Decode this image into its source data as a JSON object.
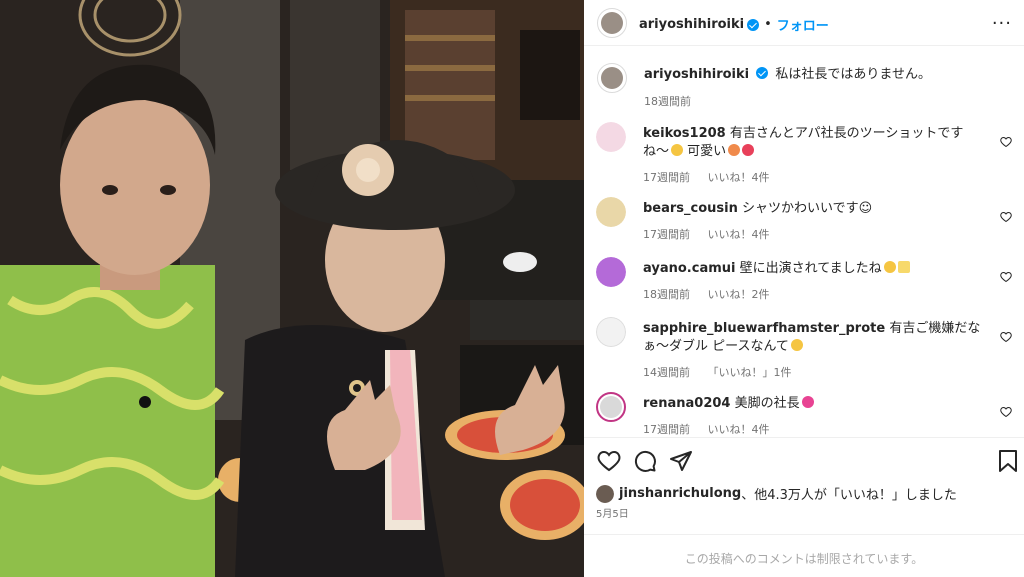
{
  "photo": {
    "alt": ""
  },
  "header": {
    "username": "ariyoshihiroiki",
    "separator": "•",
    "follow_label": "フォロー",
    "more_label": "···"
  },
  "caption": {
    "username": "ariyoshihiroiki",
    "text": "私は社長ではありません。",
    "time": "18週間前"
  },
  "comments": [
    {
      "username": "keikos1208",
      "text": "有吉さんとアパ社長のツーショットですね〜",
      "text_tail": "可愛い",
      "time": "17週間前",
      "likes": "いいね！4件",
      "avatar_color": "#f4d9e4"
    },
    {
      "username": "bears_cousin",
      "text": "シャツかわいいです☺",
      "text_tail": "",
      "time": "17週間前",
      "likes": "いいね！4件",
      "avatar_color": "#e9d7a8"
    },
    {
      "username": "ayano.camui",
      "text": "壁に出演されてましたね",
      "text_tail": "",
      "time": "18週間前",
      "likes": "いいね！2件",
      "avatar_color": "#b46ad8"
    },
    {
      "username": "sapphire_bluewarfhamster_prote",
      "text": "有吉ご機嫌だなぁ〜ダブル",
      "text_tail": "ピースなんて",
      "time": "14週間前",
      "likes": "「いいね！」1件",
      "avatar_color": "#f2f2f2"
    },
    {
      "username": "renana0204",
      "text": "美脚の社長",
      "text_tail": "",
      "time": "17週間前",
      "likes": "いいね！4件",
      "avatar_color": "#d9d9d9"
    }
  ],
  "likes_line": {
    "username": "jinshanrichulong",
    "text": "、他4.3万人が「いいね！」しました"
  },
  "date": "5月5日",
  "footer_text": "この投稿へのコメントは制限されています。",
  "colors": {
    "accent": "#0095f6",
    "text": "#262626",
    "muted": "#737373",
    "verified": "#0095f6"
  },
  "icons": [
    "heart-icon",
    "comment-icon",
    "share-icon",
    "bookmark-icon",
    "more-icon",
    "verified-icon"
  ]
}
